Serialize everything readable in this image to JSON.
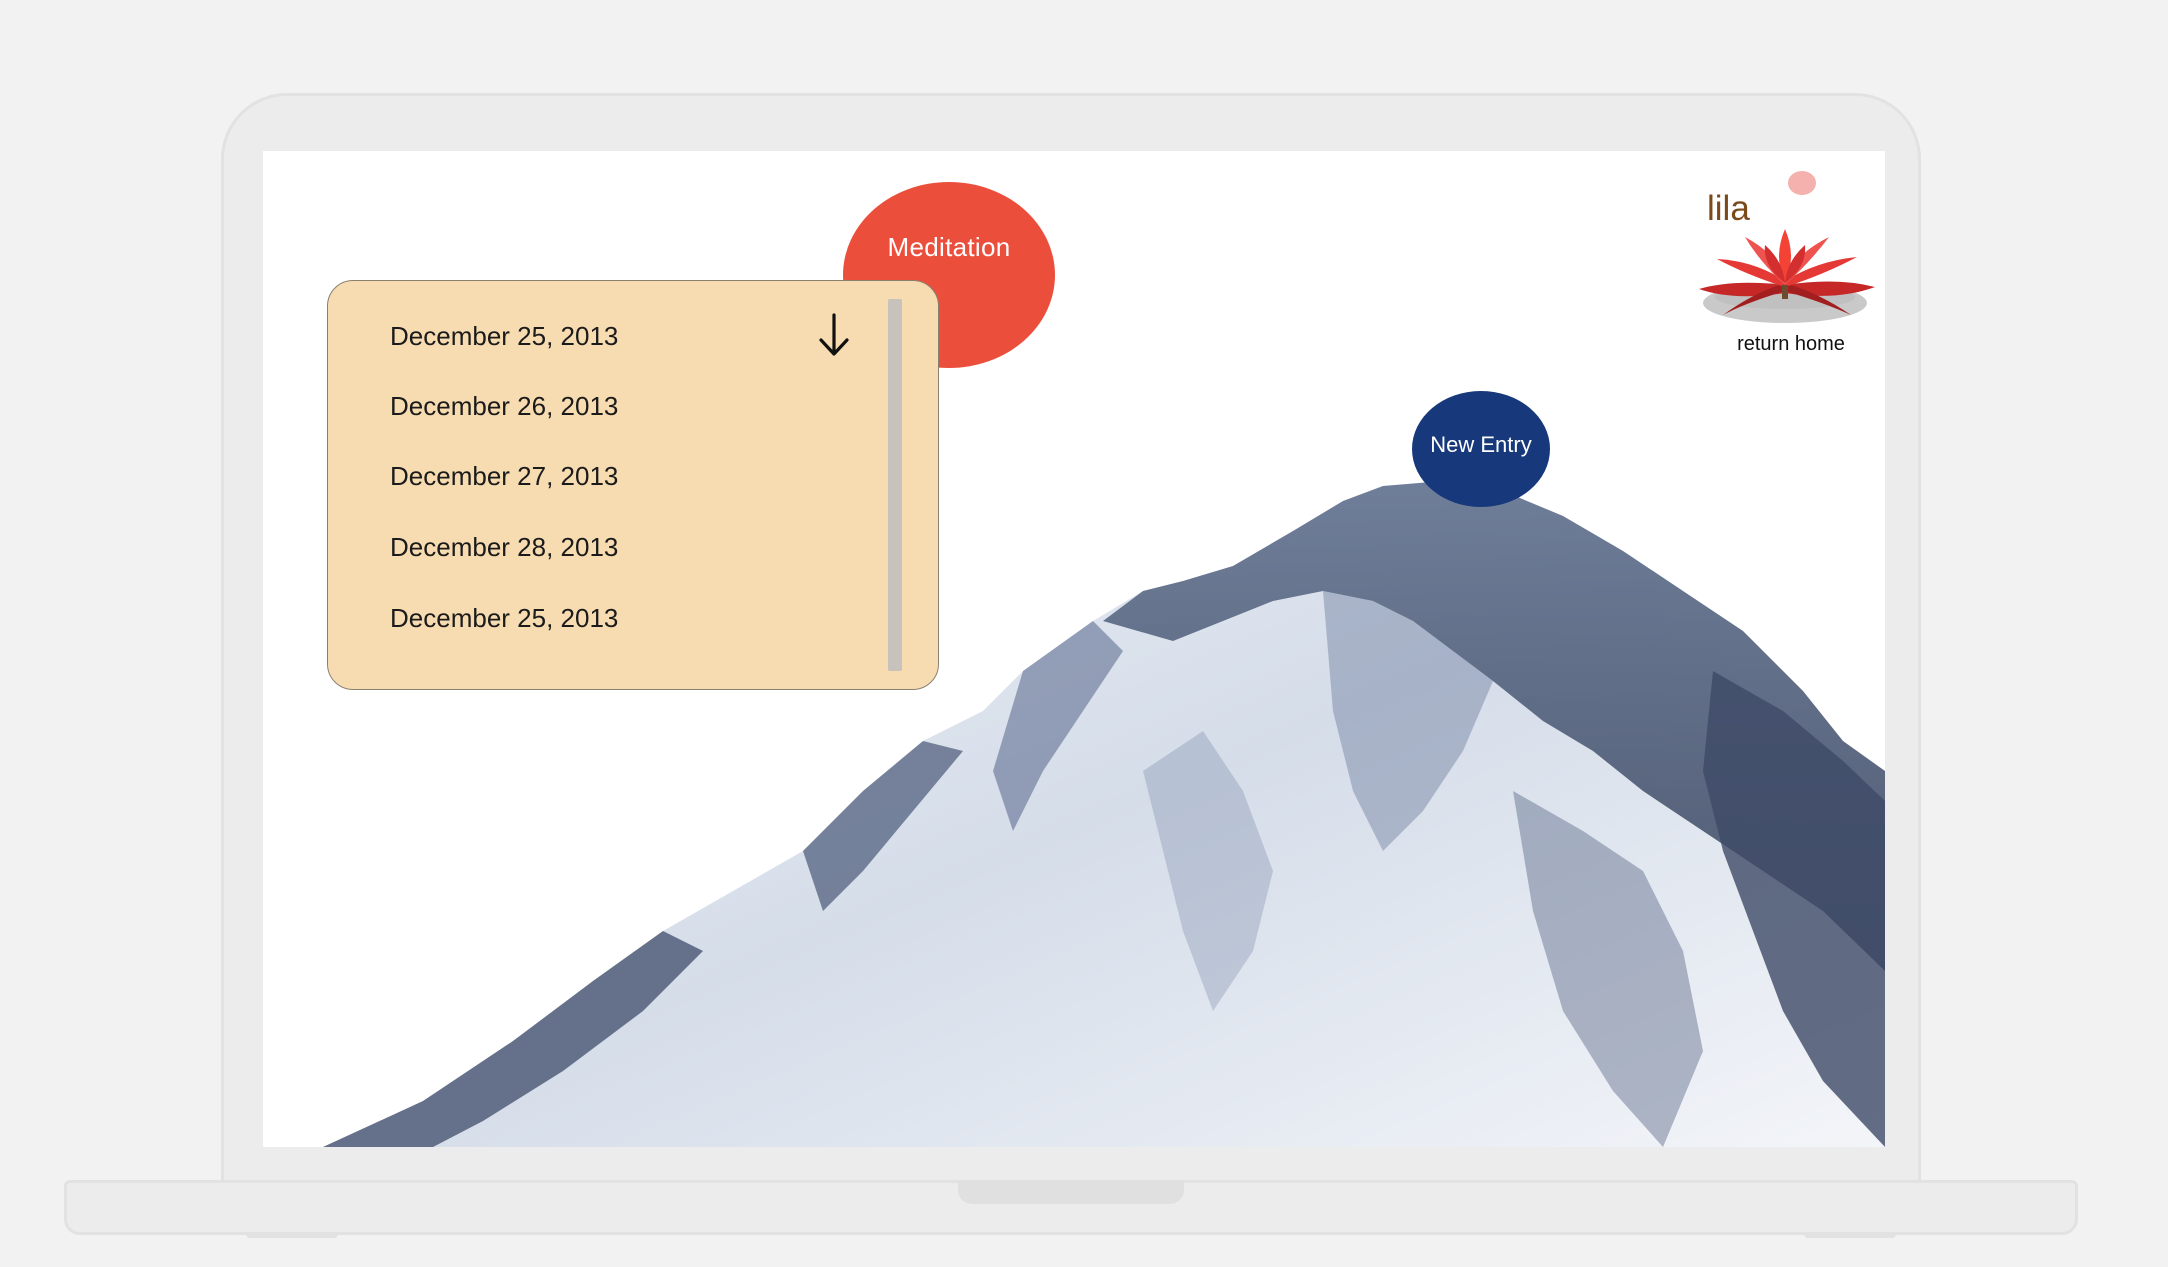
{
  "app": {
    "brand_name": "lila",
    "return_home_label": "return home"
  },
  "meditation": {
    "label": "Meditation"
  },
  "journal": {
    "entries": [
      "December 25, 2013",
      "December 26, 2013",
      "December 27, 2013",
      "December 28, 2013",
      "December 25, 2013"
    ]
  },
  "new_entry": {
    "label": "New Entry"
  },
  "icons": {
    "scroll": "arrow-down-icon",
    "home": "lotus-icon"
  },
  "colors": {
    "meditation": "#eb4f3c",
    "card": "#f8dcb1",
    "new_entry": "#17397b",
    "brand": "#7a4a1b"
  }
}
